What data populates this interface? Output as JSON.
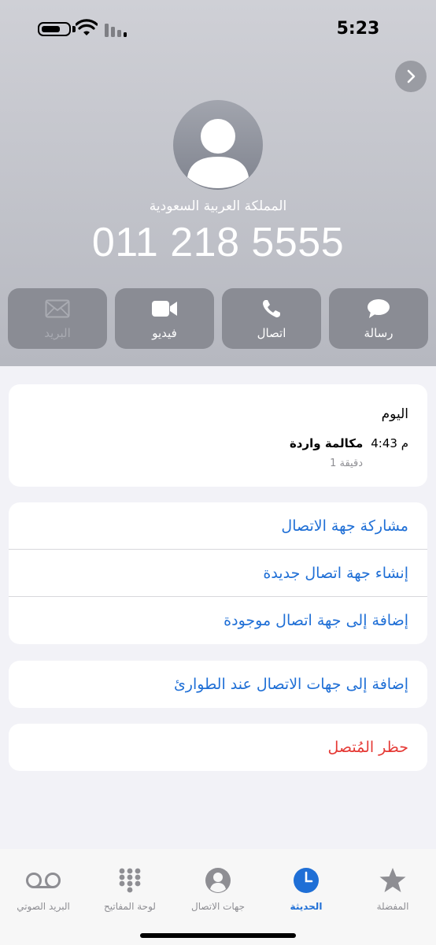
{
  "status_bar": {
    "time": "5:23"
  },
  "contact": {
    "country": "المملكة العربية السعودية",
    "phone": "011 218 5555"
  },
  "actions": [
    {
      "label": "البريد",
      "icon": "mail-icon",
      "enabled": false
    },
    {
      "label": "فيديو",
      "icon": "video-icon",
      "enabled": true
    },
    {
      "label": "اتصال",
      "icon": "phone-icon",
      "enabled": true
    },
    {
      "label": "رسالة",
      "icon": "message-icon",
      "enabled": true
    }
  ],
  "recents": {
    "day": "اليوم",
    "time": "4:43 م",
    "type": "مكالمة واردة",
    "duration": "1 دقيقة"
  },
  "options": {
    "share": "مشاركة جهة الاتصال",
    "create": "إنشاء جهة اتصال جديدة",
    "add_existing": "إضافة إلى جهة اتصال موجودة",
    "emergency": "إضافة إلى جهات الاتصال عند الطوارئ",
    "block": "حظر المُتصل"
  },
  "tabs": [
    {
      "label": "المفضلة",
      "icon": "star-icon",
      "active": false
    },
    {
      "label": "الحديثة",
      "icon": "clock-icon",
      "active": true
    },
    {
      "label": "جهات الاتصال",
      "icon": "person-circle-icon",
      "active": false
    },
    {
      "label": "لوحة المفاتيح",
      "icon": "keypad-icon",
      "active": false
    },
    {
      "label": "البريد الصوتي",
      "icon": "voicemail-icon",
      "active": false
    }
  ],
  "colors": {
    "accent": "#1f6fd6",
    "destructive": "#e53935"
  }
}
